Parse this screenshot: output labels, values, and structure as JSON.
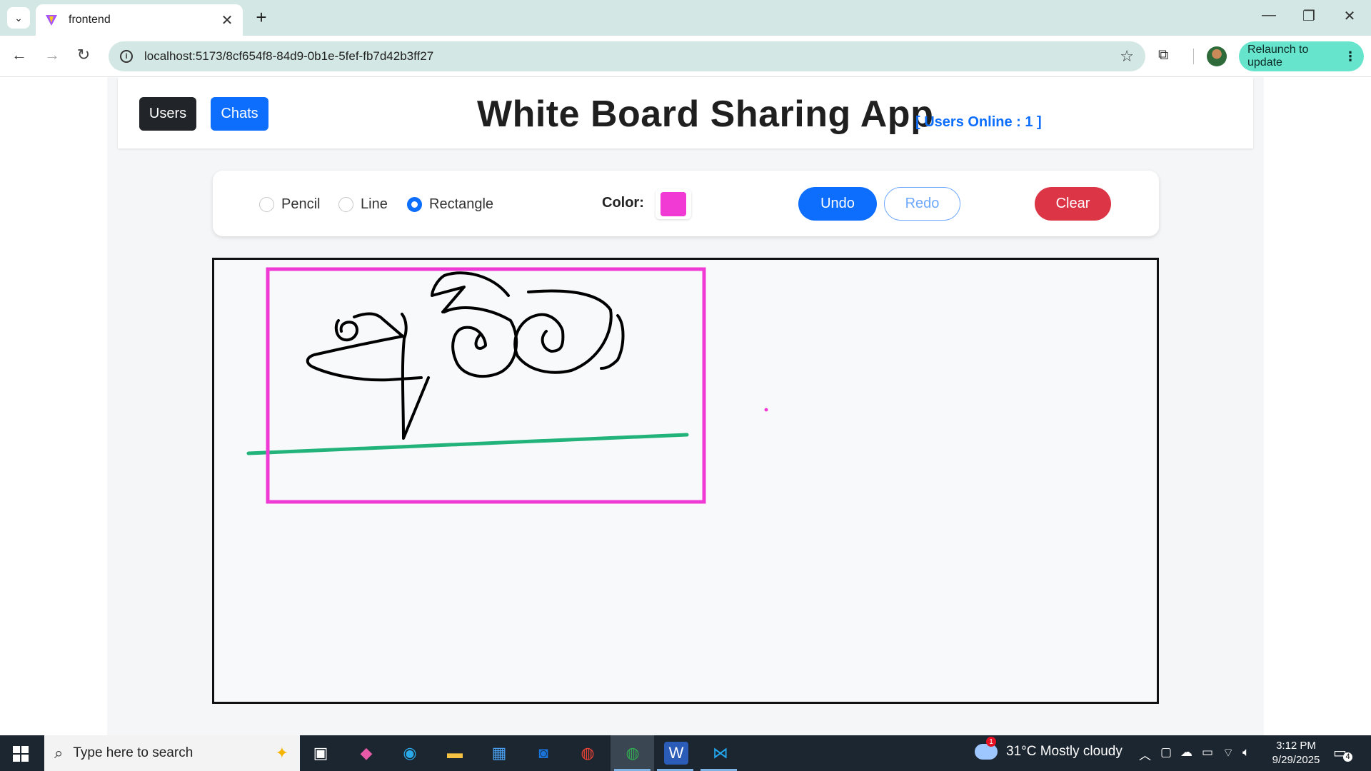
{
  "browser": {
    "tab_title": "frontend",
    "url": "localhost:5173/8cf654f8-84d9-0b1e-5fef-fb7d42b3ff27",
    "relaunch_label": "Relaunch to update",
    "new_tab_symbol": "+",
    "tab_close_symbol": "✕"
  },
  "app": {
    "users_button": "Users",
    "chats_button": "Chats",
    "title": "White Board Sharing App",
    "users_online": "[ Users Online : 1 ]"
  },
  "toolbar": {
    "tools": [
      {
        "label": "Pencil",
        "checked": false
      },
      {
        "label": "Line",
        "checked": false
      },
      {
        "label": "Rectangle",
        "checked": true
      }
    ],
    "color_label": "Color:",
    "selected_color": "#f03ad3",
    "undo_label": "Undo",
    "redo_label": "Redo",
    "clear_label": "Clear"
  },
  "canvas": {
    "stroke_colors": {
      "pencil": "#000000",
      "line": "#22b37a",
      "rectangle": "#f03ad3"
    }
  },
  "taskbar": {
    "search_placeholder": "Type here to search",
    "weather": "31°C  Mostly cloudy",
    "weather_badge": "1",
    "time": "3:12 PM",
    "date": "9/29/2025",
    "notification_count": "4"
  },
  "colors": {
    "primary": "#0d6efd",
    "dark": "#212529",
    "danger": "#dc3545",
    "browser_accent": "#d3e8e4",
    "relaunch_bg": "#67e4cc"
  }
}
